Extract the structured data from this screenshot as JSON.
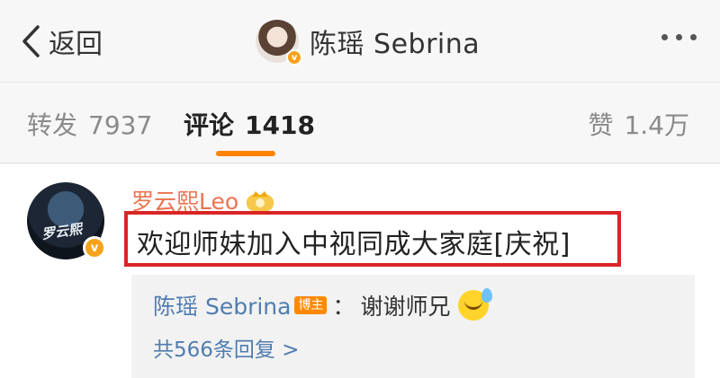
{
  "header": {
    "back_label": "返回",
    "title": "陈瑶 Sebrina",
    "verified_badge": "v",
    "more_icon": "more-dots-icon"
  },
  "tabs": [
    {
      "label": "转发",
      "count": "7937",
      "active": false
    },
    {
      "label": "评论",
      "count": "1418",
      "active": true
    },
    {
      "label": "赞",
      "count": "1.4万",
      "active": false
    }
  ],
  "accent_color": "#ff8200",
  "comment": {
    "username": "罗云熙Leo",
    "avatar_caption": "罗云熙",
    "verified_badge": "v",
    "text": "欢迎师妹加入中视同成大家庭[庆祝]",
    "highlight_color": "#d92525",
    "reply": {
      "username": "陈瑶 Sebrina",
      "badge": "博主",
      "separator": "：",
      "text": "谢谢师兄",
      "emoji": "laughing-tears-emoji"
    },
    "more_replies": "共566条回复 >"
  }
}
